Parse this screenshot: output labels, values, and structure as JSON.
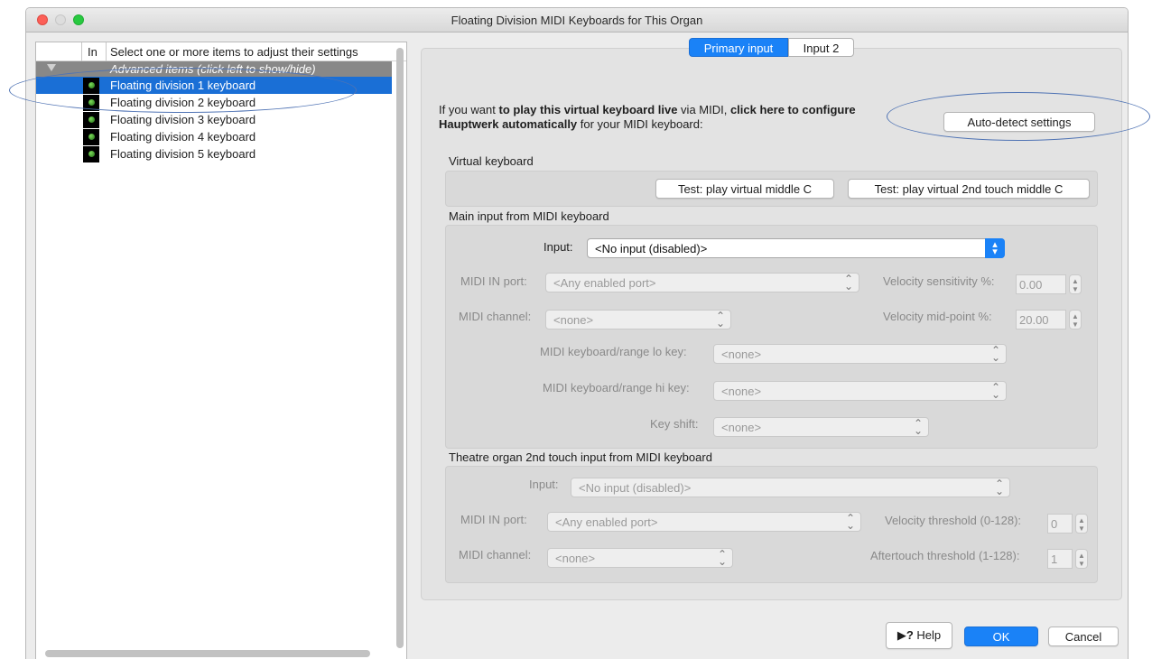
{
  "window": {
    "title": "Floating Division MIDI Keyboards for This Organ"
  },
  "tree": {
    "header_in": "In",
    "header_select": "Select one or more items to adjust their settings",
    "advanced_label": "Advanced items (click left to show/hide)",
    "items": [
      {
        "label": "Floating division 1 keyboard",
        "selected": true
      },
      {
        "label": "Floating division 2 keyboard",
        "selected": false
      },
      {
        "label": "Floating division 3 keyboard",
        "selected": false
      },
      {
        "label": "Floating division 4 keyboard",
        "selected": false
      },
      {
        "label": "Floating division 5 keyboard",
        "selected": false
      }
    ]
  },
  "tabs": [
    {
      "label": "Primary input",
      "active": true
    },
    {
      "label": "Input 2",
      "active": false
    }
  ],
  "intro": {
    "part1": "If you want ",
    "bold1": "to play this virtual keyboard live",
    "part2": " via MIDI, ",
    "bold2": "click here to configure Hauptwerk automatically",
    "part3": " for your MIDI keyboard:"
  },
  "buttons": {
    "auto_detect": "Auto-detect settings",
    "test_middle_c": "Test: play virtual middle C",
    "test_2nd_touch": "Test: play virtual 2nd touch middle C",
    "help": "Help",
    "ok": "OK",
    "cancel": "Cancel"
  },
  "sections": {
    "virtual_keyboard": "Virtual keyboard",
    "main_input": "Main input from MIDI keyboard",
    "theatre": "Theatre organ 2nd touch input from MIDI keyboard"
  },
  "main_input": {
    "input_label": "Input:",
    "input_value": "<No input (disabled)>",
    "midi_in_port_label": "MIDI IN port:",
    "midi_in_port_value": "<Any enabled port>",
    "midi_channel_label": "MIDI channel:",
    "midi_channel_value": "<none>",
    "velocity_sensitivity_label": "Velocity sensitivity %:",
    "velocity_sensitivity_value": "0.00",
    "velocity_midpoint_label": "Velocity mid-point %:",
    "velocity_midpoint_value": "20.00",
    "lo_key_label": "MIDI keyboard/range lo key:",
    "lo_key_value": "<none>",
    "hi_key_label": "MIDI keyboard/range hi key:",
    "hi_key_value": "<none>",
    "key_shift_label": "Key shift:",
    "key_shift_value": "<none>"
  },
  "theatre_input": {
    "input_label": "Input:",
    "input_value": "<No input (disabled)>",
    "midi_in_port_label": "MIDI IN port:",
    "midi_in_port_value": "<Any enabled port>",
    "midi_channel_label": "MIDI channel:",
    "midi_channel_value": "<none>",
    "velocity_threshold_label": "Velocity threshold (0-128):",
    "velocity_threshold_value": "0",
    "aftertouch_threshold_label": "Aftertouch threshold (1-128):",
    "aftertouch_threshold_value": "1"
  },
  "colors": {
    "selection": "#1a6fd6",
    "primary_button": "#1a82f7",
    "annotation": "#4f73b4"
  }
}
